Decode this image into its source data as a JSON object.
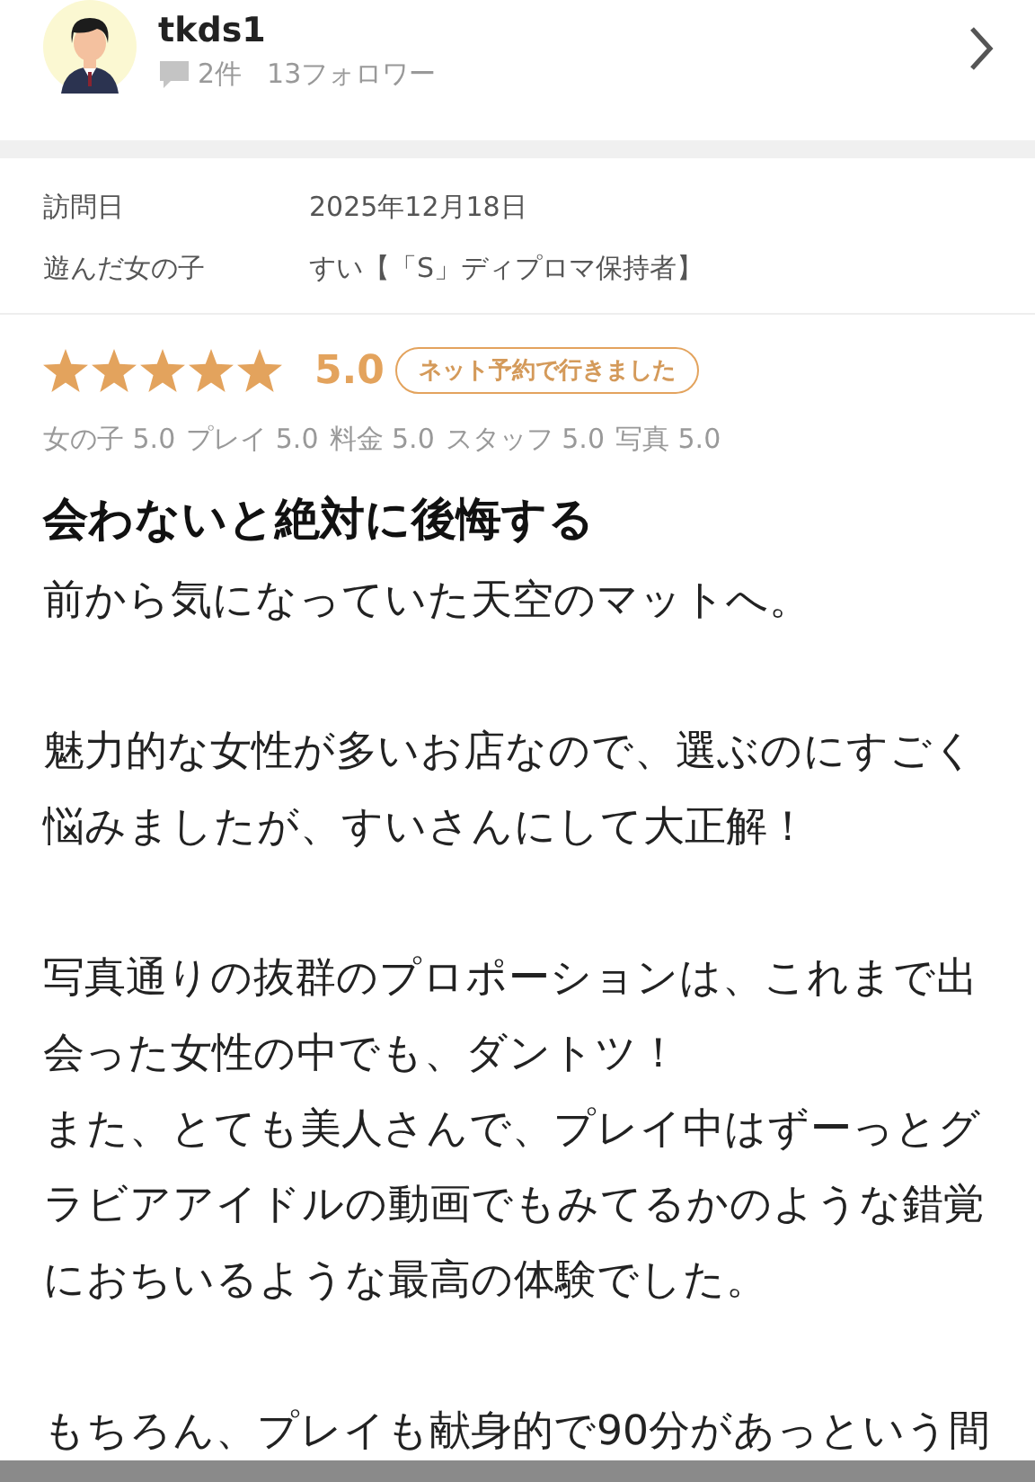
{
  "user": {
    "name": "tkds1",
    "review_count": "2件",
    "followers": "13フォロワー"
  },
  "info": [
    {
      "label": "訪問日",
      "value": "2025年12月18日"
    },
    {
      "label": "遊んだ女の子",
      "value": "すい【「S」ディプロマ保持者】"
    }
  ],
  "rating": {
    "stars": 5,
    "score": "5.0",
    "badge": "ネット予約で行きました",
    "breakdown": [
      {
        "label": "女の子",
        "score": "5.0"
      },
      {
        "label": "プレイ",
        "score": "5.0"
      },
      {
        "label": "料金",
        "score": "5.0"
      },
      {
        "label": "スタッフ",
        "score": "5.0"
      },
      {
        "label": "写真",
        "score": "5.0"
      }
    ]
  },
  "review": {
    "title": "会わないと絶対に後悔する",
    "paragraphs": [
      [
        "前から気になっていた天空のマットへ。"
      ],
      [
        "魅力的な女性が多いお店なので、選ぶのにすごく悩みましたが、すいさんにして大正解！"
      ],
      [
        "写真通りの抜群のプロポーションは、これまで出会った女性の中でも、ダントツ！",
        "また、とても美人さんで、プレイ中はずーっとグラビアアイドルの動画でもみてるかのような錯覚におちいるような最高の体験でした。"
      ],
      [
        "もちろん、プレイも献身的で90分があっという間"
      ]
    ]
  }
}
